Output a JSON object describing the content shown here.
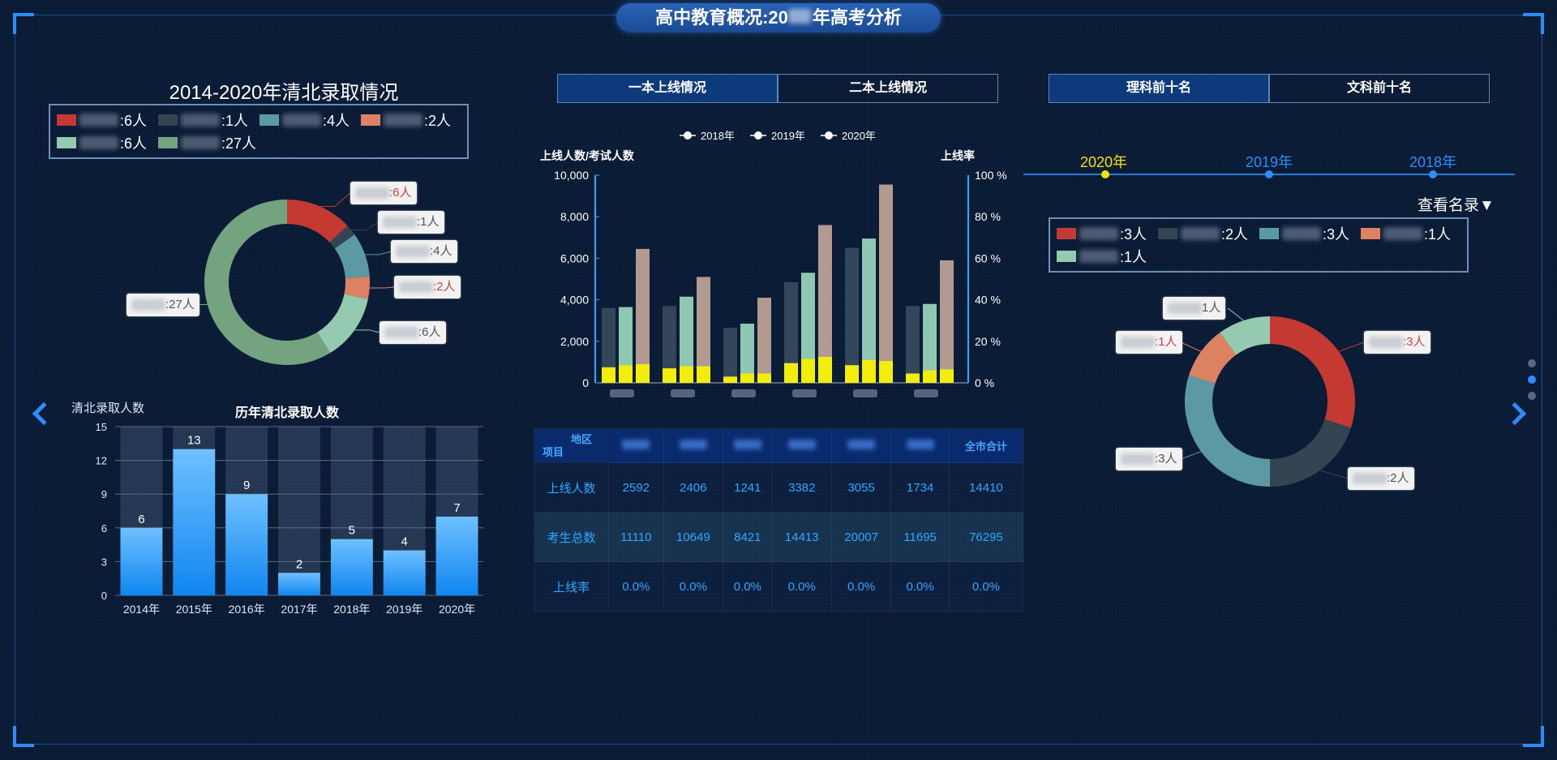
{
  "header": {
    "title_prefix": "高中教育概况:20",
    "title_suffix": "年高考分析"
  },
  "left": {
    "donut_title": "2014-2020年清北录取情况",
    "legend": [
      {
        "label": ":6人",
        "color": "#c43a32"
      },
      {
        "label": ":1人",
        "color": "#334452"
      },
      {
        "label": ":4人",
        "color": "#5c9aa3"
      },
      {
        "label": ":2人",
        "color": "#dc8262"
      },
      {
        "label": ":6人",
        "color": "#94cbb0"
      },
      {
        "label": ":27人",
        "color": "#74a37f"
      }
    ],
    "callouts": [
      ":6人",
      ":1人",
      ":4人",
      ":2人",
      ":6人",
      ":27人"
    ]
  },
  "bar_chart": {
    "ylabel": "清北录取人数",
    "title": "历年清北录取人数"
  },
  "center": {
    "tabs": [
      "一本上线情况",
      "二本上线情况"
    ],
    "legend": [
      "2018年",
      "2019年",
      "2020年"
    ],
    "ylabel_left": "上线人数/考试人数",
    "ylabel_right": "上线率",
    "y_left_ticks": [
      "10,000",
      "8,000",
      "6,000",
      "4,000",
      "2,000",
      "0"
    ],
    "y_right_ticks": [
      "100 %",
      "80 %",
      "60 %",
      "40 %",
      "20 %",
      "0 %"
    ]
  },
  "table": {
    "corner_top": "地区",
    "corner_bottom": "项目",
    "total_header": "全市合计",
    "rows": [
      {
        "label": "上线人数",
        "values": [
          "2592",
          "2406",
          "1241",
          "3382",
          "3055",
          "1734",
          "14410"
        ]
      },
      {
        "label": "考生总数",
        "values": [
          "11110",
          "10649",
          "8421",
          "14413",
          "20007",
          "11695",
          "76295"
        ]
      },
      {
        "label": "上线率",
        "values": [
          "0.0%",
          "0.0%",
          "0.0%",
          "0.0%",
          "0.0%",
          "0.0%",
          "0.0%"
        ]
      }
    ]
  },
  "right": {
    "tabs": [
      "理科前十名",
      "文科前十名"
    ],
    "timeline": [
      "2020年",
      "2019年",
      "2018年"
    ],
    "view_list": "查看名录▼",
    "legend": [
      {
        "label": ":3人",
        "color": "#c43a32"
      },
      {
        "label": ":2人",
        "color": "#334452"
      },
      {
        "label": ":3人",
        "color": "#5c9aa3"
      },
      {
        "label": ":1人",
        "color": "#dc8262"
      },
      {
        "label": ":1人",
        "color": "#94cbb0"
      }
    ],
    "callouts": [
      ":3人",
      ":2人",
      ":3人",
      ":1人",
      "1人"
    ]
  },
  "chart_data": [
    {
      "type": "pie",
      "title": "2014-2020年清北录取情况",
      "values": [
        6,
        1,
        4,
        2,
        6,
        27
      ],
      "colors": [
        "#c43a32",
        "#334452",
        "#5c9aa3",
        "#dc8262",
        "#94cbb0",
        "#74a37f"
      ]
    },
    {
      "type": "bar",
      "title": "历年清北录取人数",
      "ylabel": "清北录取人数",
      "categories": [
        "2014年",
        "2015年",
        "2016年",
        "2017年",
        "2018年",
        "2019年",
        "2020年"
      ],
      "values": [
        6,
        13,
        9,
        2,
        5,
        4,
        7
      ],
      "ylim": [
        0,
        15
      ],
      "yticks": [
        0,
        3,
        6,
        9,
        12,
        15
      ]
    },
    {
      "type": "bar",
      "ylabel": "上线人数/考试人数",
      "ylim": [
        0,
        10000
      ],
      "y2label": "上线率",
      "y2lim": [
        0,
        100
      ],
      "series": [
        {
          "name": "2018年",
          "values": [
            3600,
            3700,
            2650,
            4850,
            6500,
            3700
          ]
        },
        {
          "name": "2019年",
          "values": [
            3650,
            4150,
            2850,
            5300,
            6950,
            3800
          ]
        },
        {
          "name": "2020年",
          "values": [
            6450,
            5100,
            4100,
            7600,
            9550,
            5900
          ]
        }
      ],
      "online_series": [
        [
          750,
          700,
          300,
          950,
          850,
          450
        ],
        [
          850,
          800,
          450,
          1150,
          1100,
          600
        ],
        [
          900,
          800,
          450,
          1250,
          1050,
          650
        ]
      ],
      "legend_position": "top",
      "colors": [
        "#34465a",
        "#8ec8b2",
        "#b39a90",
        "#f2ee0a"
      ]
    },
    {
      "type": "pie",
      "values": [
        3,
        2,
        3,
        1,
        1
      ],
      "colors": [
        "#c43a32",
        "#334452",
        "#5c9aa3",
        "#dc8262",
        "#94cbb0"
      ]
    }
  ]
}
